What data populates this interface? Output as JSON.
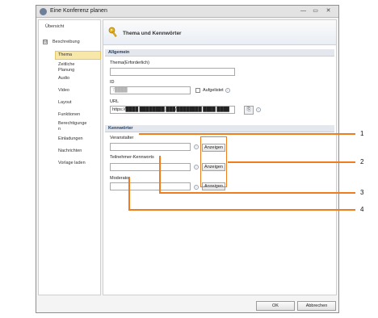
{
  "window": {
    "title": "Eine Konferenz planen",
    "controls": {
      "minimize": "—",
      "maximize": "▭",
      "close": "✕"
    }
  },
  "sidebar": {
    "items": [
      {
        "label": "Übersicht"
      },
      {
        "label": "Beschreibung",
        "toggle": "⊟"
      },
      {
        "label": "Thema"
      },
      {
        "label": "Zeitliche Planung"
      },
      {
        "label": "Audio"
      },
      {
        "label": "Video"
      },
      {
        "label": "Layout"
      },
      {
        "label": "Funktionen"
      },
      {
        "label": "Berechtigungen"
      },
      {
        "label": "Einladungen"
      },
      {
        "label": "Nachrichten"
      },
      {
        "label": "Vorlage laden"
      }
    ]
  },
  "page": {
    "title": "Thema und Kennwörter",
    "icon": "key-icon"
  },
  "sections": {
    "general": {
      "title": "Allgemein",
      "topic_label": "Thema(Erforderlich)",
      "topic_value": "",
      "id_label": "ID",
      "id_value": "7████",
      "unlisted_label": "Aufgelistet",
      "url_label": "URL",
      "url_value": "https://████ ████████.███/████████ ████ ████"
    },
    "passwords": {
      "title": "Kennwörter",
      "host_label": "Veranstalter",
      "attendee_label": "Teilnehmer-Kennworts",
      "presenter_label": "Moderator",
      "show_label": "Anzeigen"
    }
  },
  "footer": {
    "ok_label": "OK",
    "cancel_label": "Abbrechen"
  },
  "callouts": {
    "n1": "1",
    "n2": "2",
    "n3": "3",
    "n4": "4"
  },
  "colors": {
    "callout": "#f07d1d",
    "accent": "#1f3d63"
  }
}
